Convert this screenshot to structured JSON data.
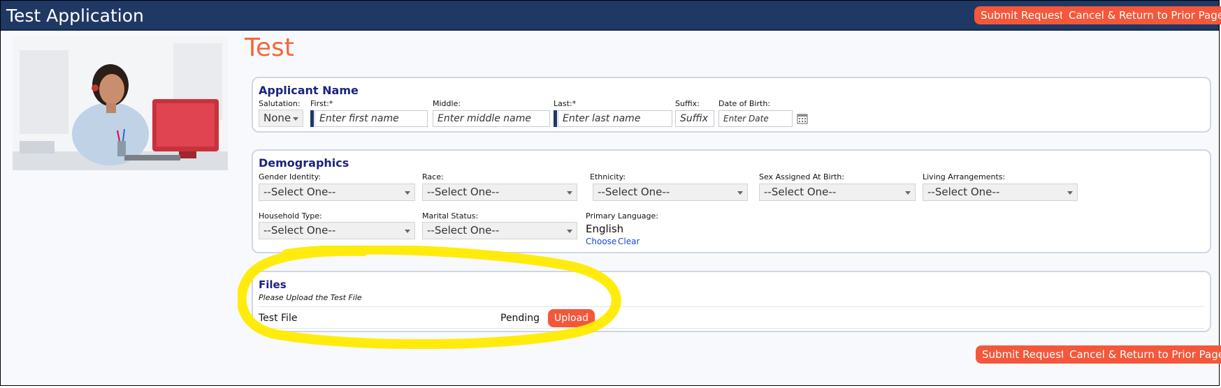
{
  "header": {
    "app_title": "Test Application",
    "submit_label": "Submit Request",
    "cancel_label": "Cancel & Return to Prior Page"
  },
  "page": {
    "title": "Test"
  },
  "applicant": {
    "section_title": "Applicant Name",
    "salutation_label": "Salutation:",
    "salutation_value": "None",
    "first_label": "First:*",
    "first_placeholder": "Enter first name",
    "middle_label": "Middle:",
    "middle_placeholder": "Enter middle name",
    "last_label": "Last:*",
    "last_placeholder": "Enter last name",
    "suffix_label": "Suffix:",
    "suffix_placeholder": "Suffix",
    "dob_label": "Date of Birth:",
    "dob_placeholder": "Enter Date"
  },
  "demographics": {
    "section_title": "Demographics",
    "fields": [
      {
        "label": "Gender Identity:",
        "value": "--Select One--"
      },
      {
        "label": "Race:",
        "value": "--Select One--"
      },
      {
        "label": "Ethnicity:",
        "value": "--Select One--"
      },
      {
        "label": "Sex Assigned At Birth:",
        "value": "--Select One--"
      },
      {
        "label": "Living Arrangements:",
        "value": "--Select One--"
      },
      {
        "label": "Household Type:",
        "value": "--Select One--"
      },
      {
        "label": "Marital Status:",
        "value": "--Select One--"
      }
    ],
    "primary_language_label": "Primary Language:",
    "primary_language_value": "English",
    "choose_label": "Choose",
    "clear_label": "Clear"
  },
  "files": {
    "section_title": "Files",
    "instructions": "Please Upload the Test File",
    "rows": [
      {
        "name": "Test File",
        "status": "Pending",
        "action": "Upload"
      }
    ]
  },
  "footer": {
    "submit_label": "Submit Request",
    "cancel_label": "Cancel & Return to Prior Page"
  },
  "colors": {
    "header_bg": "#1f3864",
    "accent": "#f4573a",
    "highlight": "#ffeb00"
  }
}
